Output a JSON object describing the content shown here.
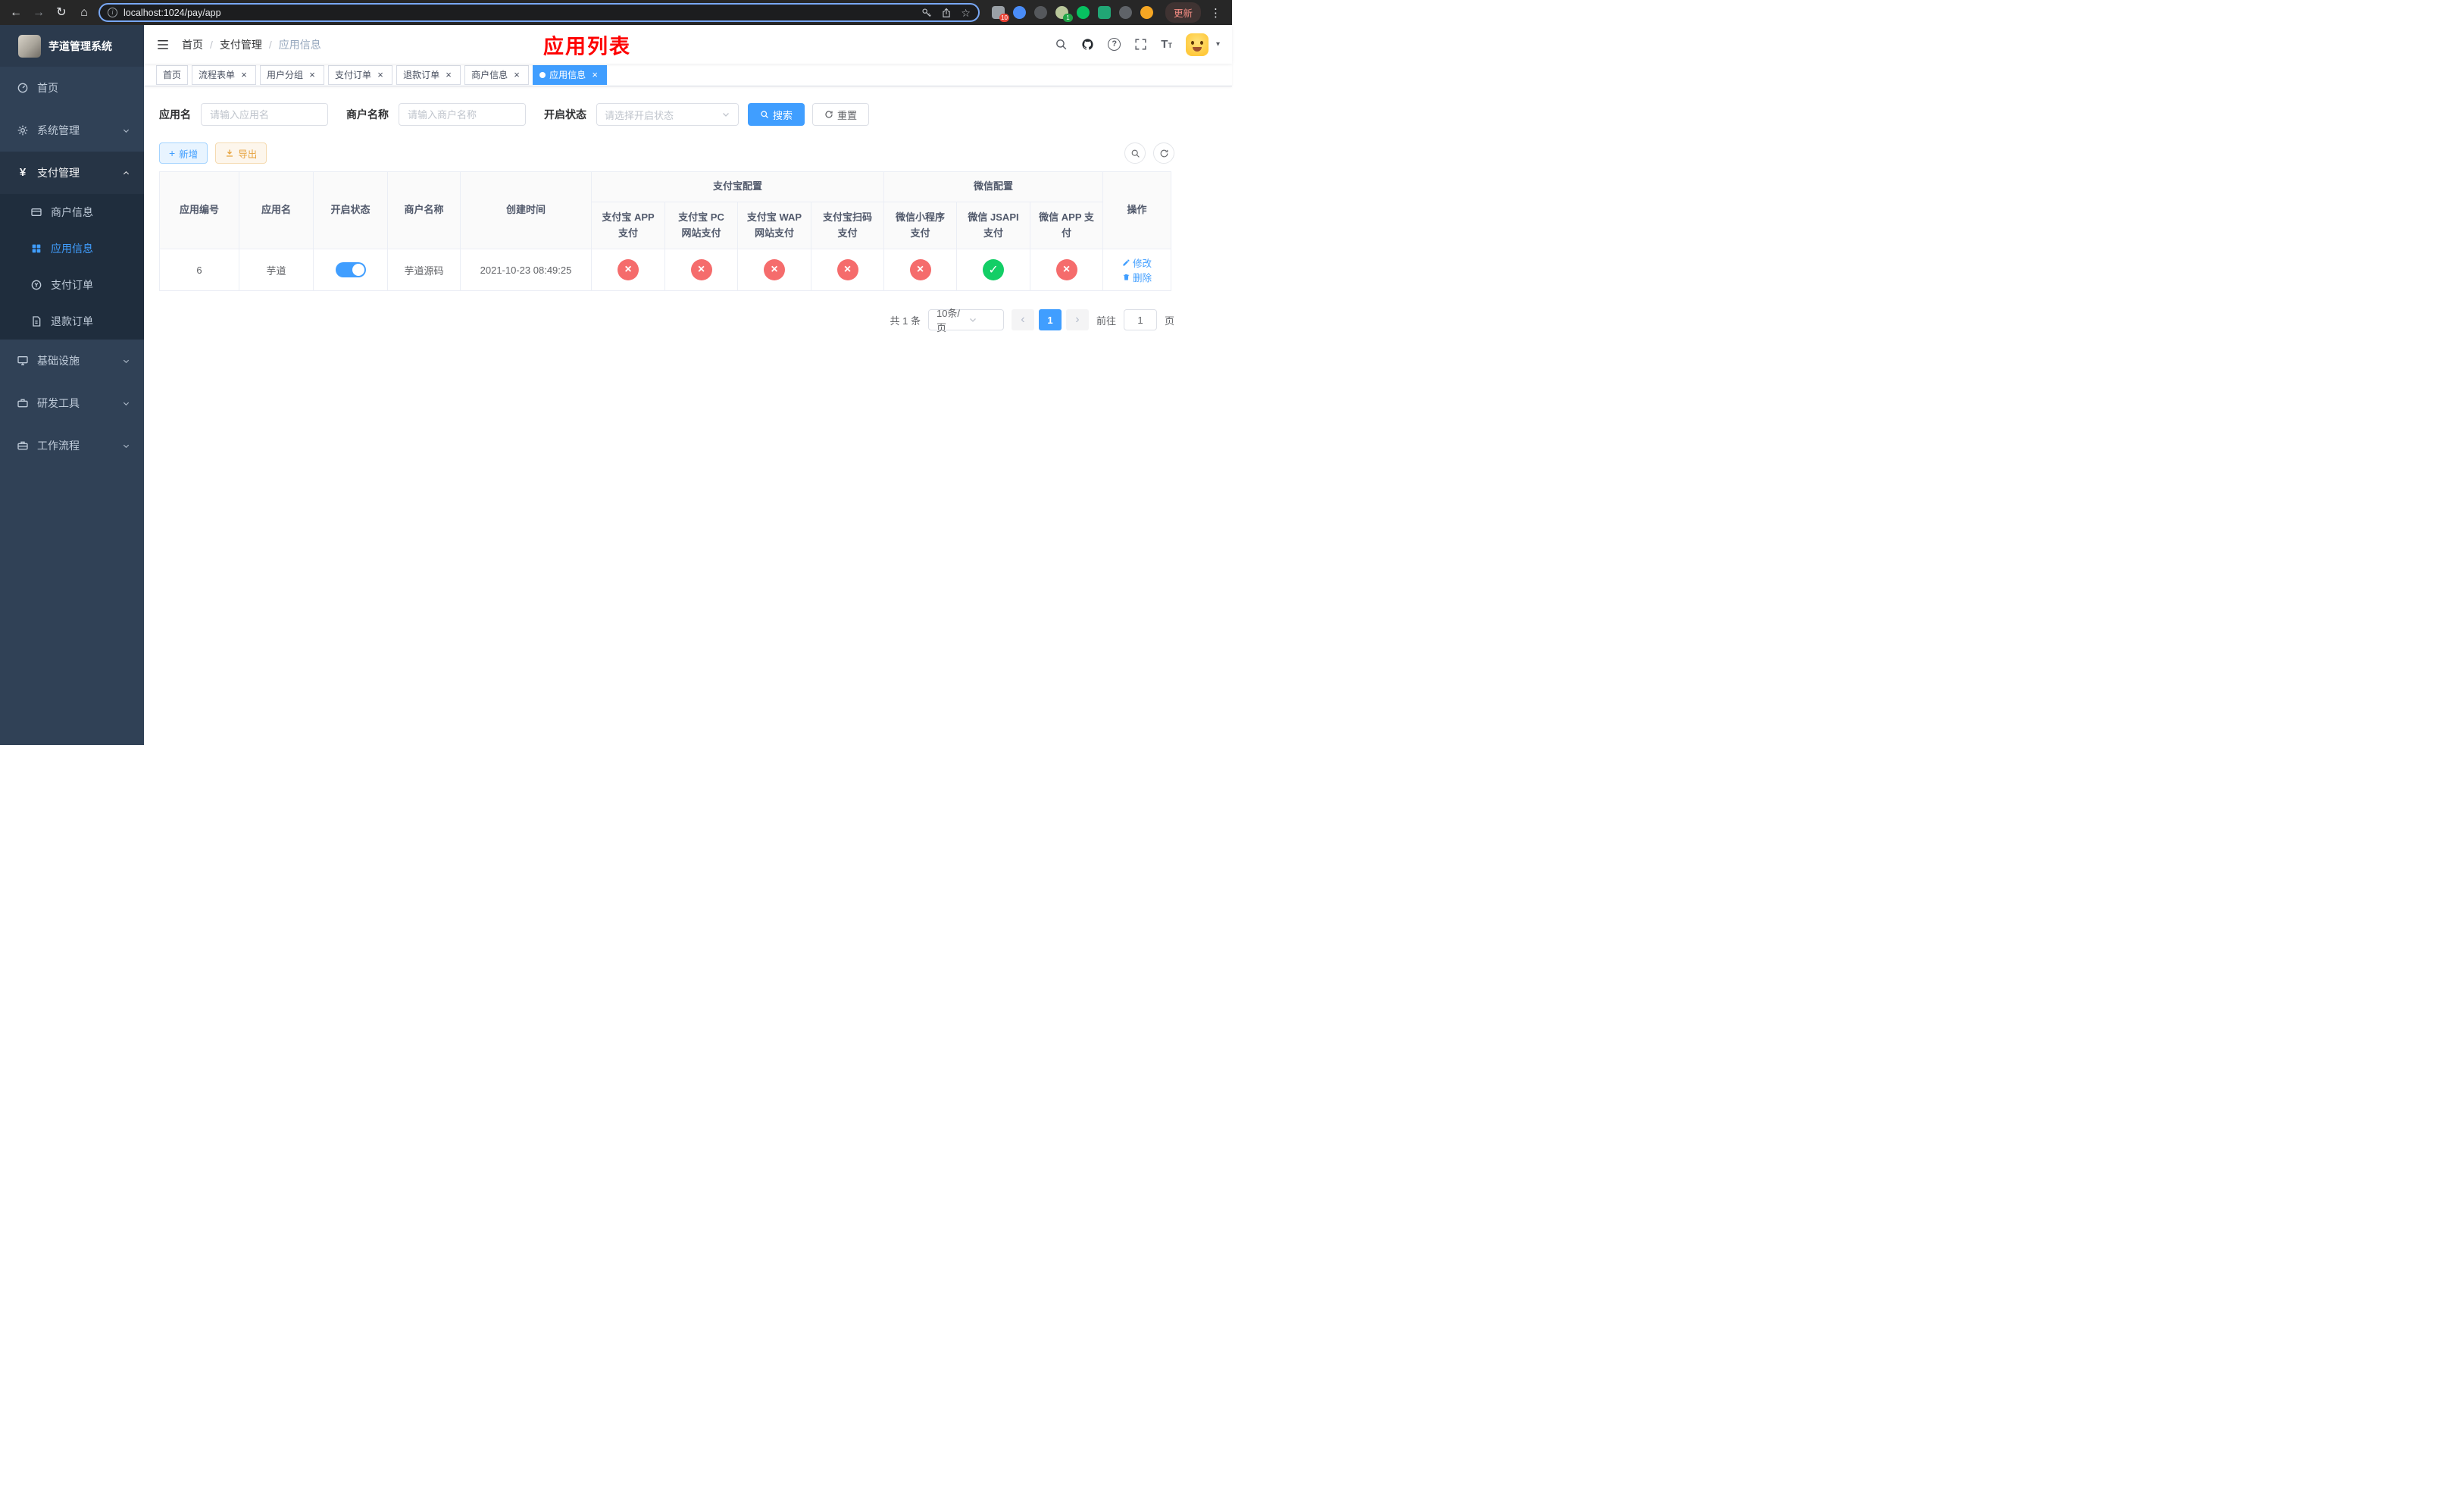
{
  "browser": {
    "url": "localhost:1024/pay/app",
    "update_button": "更新",
    "extension_badges": {
      "first": "10",
      "fourth": "1"
    }
  },
  "icons": {
    "back": "←",
    "forward": "→",
    "refresh": "↻",
    "home": "⌂",
    "info": "i",
    "star": "☆",
    "menu_dots": "⋮",
    "plus": "+",
    "close": "×",
    "caret_down": "▾",
    "question": "?",
    "prev": "‹",
    "next": "›",
    "text_size": "T"
  },
  "sidebar": {
    "title": "芋道管理系统",
    "items": [
      {
        "label": "首页"
      },
      {
        "label": "系统管理"
      },
      {
        "label": "支付管理"
      },
      {
        "label": "商户信息"
      },
      {
        "label": "应用信息"
      },
      {
        "label": "支付订单"
      },
      {
        "label": "退款订单"
      },
      {
        "label": "基础设施"
      },
      {
        "label": "研发工具"
      },
      {
        "label": "工作流程"
      }
    ]
  },
  "navbar": {
    "breadcrumb": [
      {
        "label": "首页"
      },
      {
        "label": "支付管理"
      },
      {
        "label": "应用信息"
      }
    ],
    "page_title": "应用列表"
  },
  "tabs": [
    {
      "label": "首页"
    },
    {
      "label": "流程表单"
    },
    {
      "label": "用户分组"
    },
    {
      "label": "支付订单"
    },
    {
      "label": "退款订单"
    },
    {
      "label": "商户信息"
    },
    {
      "label": "应用信息"
    }
  ],
  "filters": {
    "app_name": {
      "label": "应用名",
      "placeholder": "请输入应用名",
      "value": ""
    },
    "merchant_name": {
      "label": "商户名称",
      "placeholder": "请输入商户名称",
      "value": ""
    },
    "status": {
      "label": "开启状态",
      "placeholder": "请选择开启状态"
    },
    "search_button": "搜索",
    "reset_button": "重置"
  },
  "toolbar": {
    "add_button": "新增",
    "export_button": "导出"
  },
  "table": {
    "headers": {
      "app_id": "应用编号",
      "app_name": "应用名",
      "status": "开启状态",
      "merchant_name": "商户名称",
      "create_time": "创建时间",
      "alipay_group": "支付宝配置",
      "wechat_group": "微信配置",
      "channels": [
        "支付宝 APP 支付",
        "支付宝 PC 网站支付",
        "支付宝 WAP 网站支付",
        "支付宝扫码支付",
        "微信小程序支付",
        "微信 JSAPI 支付",
        "微信 APP 支付"
      ],
      "actions": "操作"
    },
    "rows": [
      {
        "app_id": "6",
        "app_name": "芋道",
        "status_on": true,
        "merchant_name": "芋道源码",
        "create_time": "2021-10-23 08:49:25",
        "channels": [
          "no",
          "no",
          "no",
          "no",
          "no",
          "yes",
          "no"
        ],
        "edit_button": "修改",
        "delete_button": "删除"
      }
    ]
  },
  "pagination": {
    "total": "共 1 条",
    "page_size": "10条/页",
    "current_page": "1",
    "goto_label": "前往",
    "goto_value": "1",
    "goto_suffix": "页"
  },
  "colors": {
    "accent": "#409eff",
    "danger": "#f56c6c",
    "success": "#13ce66",
    "warning": "#e6a23c",
    "title_red": "#fe0000",
    "sidebar_bg": "#304156"
  }
}
